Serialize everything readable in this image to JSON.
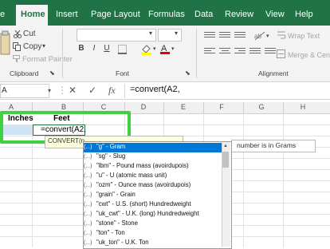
{
  "menu": {
    "file": "e",
    "home": "Home",
    "insert": "Insert",
    "page_layout": "Page Layout",
    "formulas": "Formulas",
    "data": "Data",
    "review": "Review",
    "view": "View",
    "help": "Help"
  },
  "ribbon": {
    "cut": "Cut",
    "copy": "Copy",
    "format_painter": "Format Painter",
    "clipboard": "Clipboard",
    "font": "Font",
    "bold": "B",
    "italic": "I",
    "underline": "U",
    "wrap_text": "Wrap Text",
    "merge_center": "Merge & Cen",
    "alignment": "Alignment"
  },
  "formula_bar": {
    "name_box": "A",
    "cancel": "✕",
    "enter": "✓",
    "fx": "fx",
    "content": "=convert(A2,"
  },
  "columns": [
    "A",
    "B",
    "C",
    "D",
    "E",
    "F",
    "G",
    "H"
  ],
  "cells": {
    "a1": "Inches",
    "b1": "Feet",
    "b2": "=convert(A2,"
  },
  "tooltip": "CONVERT(n",
  "tooltip_hint": "number is in Grams",
  "dropdown": {
    "glyph": "(...)",
    "items": [
      "\"g\" - Gram",
      "\"sg\" - Slug",
      "\"lbm\" - Pound mass (avoirdupois)",
      "\"u\" - U (atomic mass unit)",
      "\"ozm\" - Ounce mass (avoirdupois)",
      "\"grain\" - Grain",
      "\"cwt\" - U.S. (short) Hundredweight",
      "\"uk_cwt\" - U.K. (long) Hundredweight",
      "\"stone\" - Stone",
      "\"ton\" - Ton",
      "\"uk_ton\" - U.K. Ton"
    ]
  },
  "colors": {
    "excel_green": "#217346",
    "highlight": "#3fd13f",
    "selection": "#0078d7"
  }
}
